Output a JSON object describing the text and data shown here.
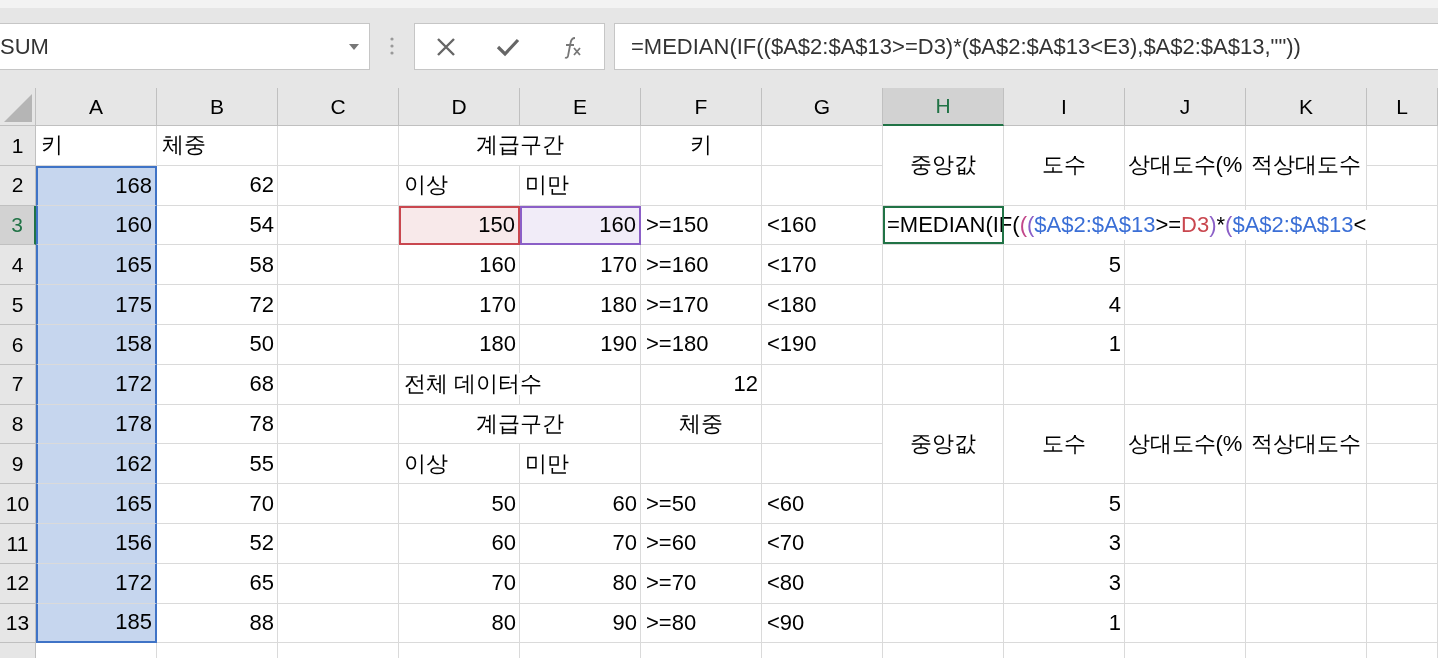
{
  "name_box": {
    "value": "SUM"
  },
  "formula_bar": {
    "formula": "=MEDIAN(IF(($A$2:$A$13>=D3)*($A$2:$A$13<E3),$A$2:$A$13,\"\"))"
  },
  "columns": [
    {
      "label": "A",
      "selected": false
    },
    {
      "label": "B",
      "selected": false
    },
    {
      "label": "C",
      "selected": false
    },
    {
      "label": "D",
      "selected": false
    },
    {
      "label": "E",
      "selected": false
    },
    {
      "label": "F",
      "selected": false
    },
    {
      "label": "G",
      "selected": false
    },
    {
      "label": "H",
      "selected": true
    },
    {
      "label": "I",
      "selected": false
    },
    {
      "label": "J",
      "selected": false
    },
    {
      "label": "K",
      "selected": false
    },
    {
      "label": "L",
      "selected": false
    }
  ],
  "rows": [
    {
      "number": "1",
      "selected": false,
      "cells": {
        "A": {
          "kind": "text",
          "text": "키",
          "selected": false
        },
        "B": {
          "kind": "text",
          "text": "체중"
        },
        "D": {
          "kind": "header",
          "text": "계급구간"
        },
        "F": {
          "kind": "header",
          "text": "키"
        },
        "H": {
          "kind": "header",
          "text": "중앙값"
        },
        "I": {
          "kind": "header",
          "text": "도수"
        },
        "J": {
          "kind": "header",
          "text": "상대도수(%"
        },
        "K": {
          "kind": "header",
          "text": "적상대도수"
        }
      }
    },
    {
      "number": "2",
      "selected": false,
      "cells": {
        "A": {
          "kind": "number",
          "text": "168",
          "selected": true
        },
        "B": {
          "kind": "number",
          "text": "62"
        },
        "D": {
          "kind": "text",
          "text": "이상"
        },
        "E": {
          "kind": "text",
          "text": "미만"
        }
      }
    },
    {
      "number": "3",
      "selected": true,
      "cells": {
        "A": {
          "kind": "number",
          "text": "160",
          "selected": true
        },
        "B": {
          "kind": "number",
          "text": "54"
        },
        "D": {
          "kind": "number",
          "text": "150",
          "color": "#c9474f"
        },
        "E": {
          "kind": "number",
          "text": "160",
          "color": "#8b5fc7"
        },
        "F": {
          "kind": "text",
          "text": ">=150"
        },
        "G": {
          "kind": "text",
          "text": "<160"
        },
        "H": {
          "kind": "formula",
          "selected": true,
          "segments": [
            {
              "text": "=MEDIAN(IF(",
              "color": "#000000"
            },
            {
              "text": "(",
              "color": "#c2478a"
            },
            {
              "text": "(",
              "color": "#8b5fc7"
            },
            {
              "text": "$A$2:$A$13",
              "color": "#3b6fd6"
            },
            {
              "text": ">=",
              "color": "#000000"
            },
            {
              "text": "D3",
              "color": "#c9474f"
            },
            {
              "text": ")",
              "color": "#8b5fc7"
            },
            {
              "text": "*",
              "color": "#000000"
            },
            {
              "text": "(",
              "color": "#8b5fc7"
            },
            {
              "text": "$A$2:$A$13",
              "color": "#3b6fd6"
            },
            {
              "text": "<",
              "color": "#000000"
            }
          ]
        }
      }
    },
    {
      "number": "4",
      "selected": false,
      "cells": {
        "A": {
          "kind": "number",
          "text": "165",
          "selected": true
        },
        "B": {
          "kind": "number",
          "text": "58"
        },
        "D": {
          "kind": "number",
          "text": "160"
        },
        "E": {
          "kind": "number",
          "text": "170"
        },
        "F": {
          "kind": "text",
          "text": ">=160"
        },
        "G": {
          "kind": "text",
          "text": "<170"
        },
        "I": {
          "kind": "number",
          "text": "5"
        }
      }
    },
    {
      "number": "5",
      "selected": false,
      "cells": {
        "A": {
          "kind": "number",
          "text": "175",
          "selected": true
        },
        "B": {
          "kind": "number",
          "text": "72"
        },
        "D": {
          "kind": "number",
          "text": "170"
        },
        "E": {
          "kind": "number",
          "text": "180"
        },
        "F": {
          "kind": "text",
          "text": ">=170"
        },
        "G": {
          "kind": "text",
          "text": "<180"
        },
        "I": {
          "kind": "number",
          "text": "4"
        }
      }
    },
    {
      "number": "6",
      "selected": false,
      "cells": {
        "A": {
          "kind": "number",
          "text": "158",
          "selected": true
        },
        "B": {
          "kind": "number",
          "text": "50"
        },
        "D": {
          "kind": "number",
          "text": "180"
        },
        "E": {
          "kind": "number",
          "text": "190"
        },
        "F": {
          "kind": "text",
          "text": ">=180"
        },
        "G": {
          "kind": "text",
          "text": "<190"
        },
        "I": {
          "kind": "number",
          "text": "1"
        }
      }
    },
    {
      "number": "7",
      "selected": false,
      "cells": {
        "A": {
          "kind": "number",
          "text": "172",
          "selected": true
        },
        "B": {
          "kind": "number",
          "text": "68"
        },
        "D": {
          "kind": "overflow",
          "text": "전체 데이터수"
        },
        "F": {
          "kind": "number",
          "text": "12"
        }
      }
    },
    {
      "number": "8",
      "selected": false,
      "cells": {
        "A": {
          "kind": "number",
          "text": "178",
          "selected": true
        },
        "B": {
          "kind": "number",
          "text": "78"
        },
        "D": {
          "kind": "header",
          "text": "계급구간"
        },
        "F": {
          "kind": "header",
          "text": "체중"
        },
        "H": {
          "kind": "header",
          "text": "중앙값"
        },
        "I": {
          "kind": "header",
          "text": "도수"
        },
        "J": {
          "kind": "header",
          "text": "상대도수(%"
        },
        "K": {
          "kind": "header",
          "text": "적상대도수"
        }
      }
    },
    {
      "number": "9",
      "selected": false,
      "cells": {
        "A": {
          "kind": "number",
          "text": "162",
          "selected": true
        },
        "B": {
          "kind": "number",
          "text": "55"
        },
        "D": {
          "kind": "text",
          "text": "이상"
        },
        "E": {
          "kind": "text",
          "text": "미만"
        }
      }
    },
    {
      "number": "10",
      "selected": false,
      "cells": {
        "A": {
          "kind": "number",
          "text": "165",
          "selected": true
        },
        "B": {
          "kind": "number",
          "text": "70"
        },
        "D": {
          "kind": "number",
          "text": "50"
        },
        "E": {
          "kind": "number",
          "text": "60"
        },
        "F": {
          "kind": "text",
          "text": ">=50"
        },
        "G": {
          "kind": "text",
          "text": "<60"
        },
        "I": {
          "kind": "number",
          "text": "5"
        }
      }
    },
    {
      "number": "11",
      "selected": false,
      "cells": {
        "A": {
          "kind": "number",
          "text": "156",
          "selected": true
        },
        "B": {
          "kind": "number",
          "text": "52"
        },
        "D": {
          "kind": "number",
          "text": "60"
        },
        "E": {
          "kind": "number",
          "text": "70"
        },
        "F": {
          "kind": "text",
          "text": ">=60"
        },
        "G": {
          "kind": "text",
          "text": "<70"
        },
        "I": {
          "kind": "number",
          "text": "3"
        }
      }
    },
    {
      "number": "12",
      "selected": false,
      "cells": {
        "A": {
          "kind": "number",
          "text": "172",
          "selected": true
        },
        "B": {
          "kind": "number",
          "text": "65"
        },
        "D": {
          "kind": "number",
          "text": "70"
        },
        "E": {
          "kind": "number",
          "text": "80"
        },
        "F": {
          "kind": "text",
          "text": ">=70"
        },
        "G": {
          "kind": "text",
          "text": "<80"
        },
        "I": {
          "kind": "number",
          "text": "3"
        }
      }
    },
    {
      "number": "13",
      "selected": false,
      "cells": {
        "A": {
          "kind": "number",
          "text": "185",
          "selected": true
        },
        "B": {
          "kind": "number",
          "text": "88"
        },
        "D": {
          "kind": "number",
          "text": "80"
        },
        "E": {
          "kind": "number",
          "text": "90"
        },
        "F": {
          "kind": "text",
          "text": ">=80"
        },
        "G": {
          "kind": "text",
          "text": "<90"
        },
        "I": {
          "kind": "number",
          "text": "1"
        }
      }
    }
  ]
}
